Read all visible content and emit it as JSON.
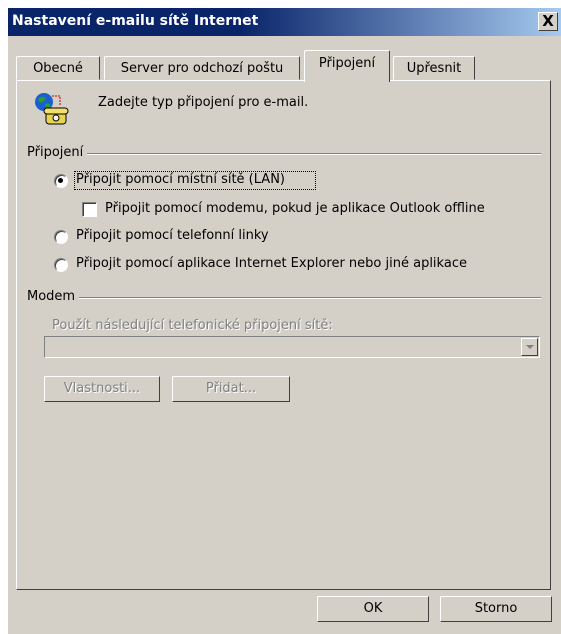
{
  "window": {
    "title": "Nastavení e-mailu sítě Internet",
    "close_symbol": "X"
  },
  "tabs": [
    {
      "label": "Obecné"
    },
    {
      "label": "Server pro odchozí poštu"
    },
    {
      "label": "Připojení",
      "active": true
    },
    {
      "label": "Upřesnit"
    }
  ],
  "panel": {
    "intro_text": "Zadejte typ připojení pro e-mail.",
    "connection_group": {
      "label": "Připojení",
      "options": [
        {
          "label": "Připojit pomocí místní sítě (LAN)",
          "selected": true
        },
        {
          "label": "Připojit pomocí telefonní linky",
          "selected": false
        },
        {
          "label": "Připojit pomocí aplikace Internet Explorer nebo jiné aplikace",
          "selected": false
        }
      ],
      "modem_checkbox": {
        "label": "Připojit pomocí modemu, pokud je aplikace Outlook offline",
        "checked": false
      }
    },
    "modem_group": {
      "label": "Modem",
      "dialup_label": "Použít následující telefonické připojení sítě:",
      "dialup_value": "",
      "properties_button": "Vlastnosti...",
      "add_button": "Přidat..."
    }
  },
  "footer": {
    "ok": "OK",
    "cancel": "Storno"
  },
  "icons": {
    "intro_icon": "globe-phone-icon"
  }
}
